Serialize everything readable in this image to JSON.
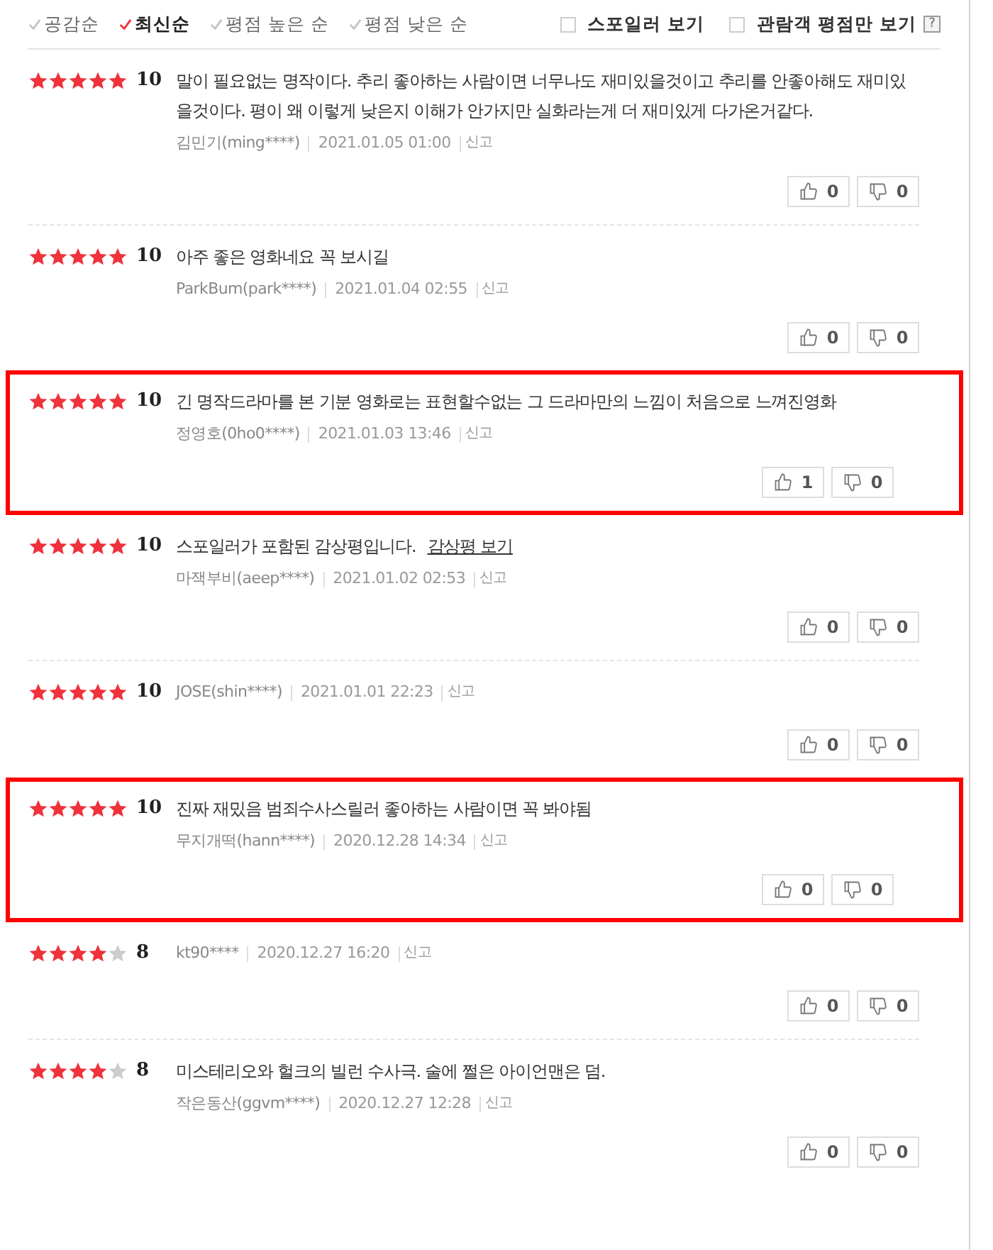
{
  "sort_options": [
    {
      "label": "공감순",
      "selected": false
    },
    {
      "label": "최신순",
      "selected": true
    },
    {
      "label": "평점 높은 순",
      "selected": false
    },
    {
      "label": "평점 낮은 순",
      "selected": false
    }
  ],
  "filters": [
    {
      "label": "스포일러 보기",
      "checked": false
    },
    {
      "label": "관람객 평점만 보기",
      "checked": false
    }
  ],
  "help": "?",
  "reviews": [
    {
      "stars": 5,
      "score": "10",
      "kind": "text",
      "text": "말이 필요없는 명작이다. 추리 좋아하는 사람이면 너무나도 재미있을것이고 추리를 안좋아해도 재미있을것이다. 평이 왜 이렇게 낮은지 이해가 안가지만 실화라는게 더 재미있게 다가온거같다.",
      "author": "김민기(ming****)",
      "date": "2021.01.05 01:00",
      "report": "신고",
      "likes": "0",
      "dislikes": "0",
      "highlighted": false
    },
    {
      "stars": 5,
      "score": "10",
      "kind": "text",
      "text": "아주 좋은 영화네요 꼭 보시길",
      "author": "ParkBum(park****)",
      "date": "2021.01.04 02:55",
      "report": "신고",
      "likes": "0",
      "dislikes": "0",
      "highlighted": false
    },
    {
      "stars": 5,
      "score": "10",
      "kind": "text",
      "text": "긴 명작드라마를 본 기분 영화로는 표현할수없는 그 드라마만의 느낌이 처음으로 느껴진영화",
      "author": "정영호(0ho0****)",
      "date": "2021.01.03 13:46",
      "report": "신고",
      "likes": "1",
      "dislikes": "0",
      "highlighted": true
    },
    {
      "stars": 5,
      "score": "10",
      "kind": "spoiler",
      "text": "스포일러가 포함된 감상평입니다.",
      "link": "감상평 보기",
      "author": "마잭부비(aeep****)",
      "date": "2021.01.02 02:53",
      "report": "신고",
      "likes": "0",
      "dislikes": "0",
      "highlighted": false
    },
    {
      "stars": 5,
      "score": "10",
      "kind": "empty",
      "author": "JOSE(shin****)",
      "date": "2021.01.01 22:23",
      "report": "신고",
      "likes": "0",
      "dislikes": "0",
      "highlighted": false
    },
    {
      "stars": 5,
      "score": "10",
      "kind": "text",
      "text": "진짜 재밌음 범죄수사스릴러 좋아하는 사람이면 꼭 봐야됨",
      "author": "무지개떡(hann****)",
      "date": "2020.12.28 14:34",
      "report": "신고",
      "likes": "0",
      "dislikes": "0",
      "highlighted": true
    },
    {
      "stars": 4,
      "score": "8",
      "kind": "empty",
      "author": "kt90****",
      "date": "2020.12.27 16:20",
      "report": "신고",
      "likes": "0",
      "dislikes": "0",
      "highlighted": false
    },
    {
      "stars": 4,
      "score": "8",
      "kind": "text",
      "text": "미스테리오와 헐크의 빌런 수사극. 술에 쩔은 아이언맨은 덤.",
      "author": "작은동산(ggvm****)",
      "date": "2020.12.27 12:28",
      "report": "신고",
      "likes": "0",
      "dislikes": "0",
      "highlighted": false
    }
  ]
}
